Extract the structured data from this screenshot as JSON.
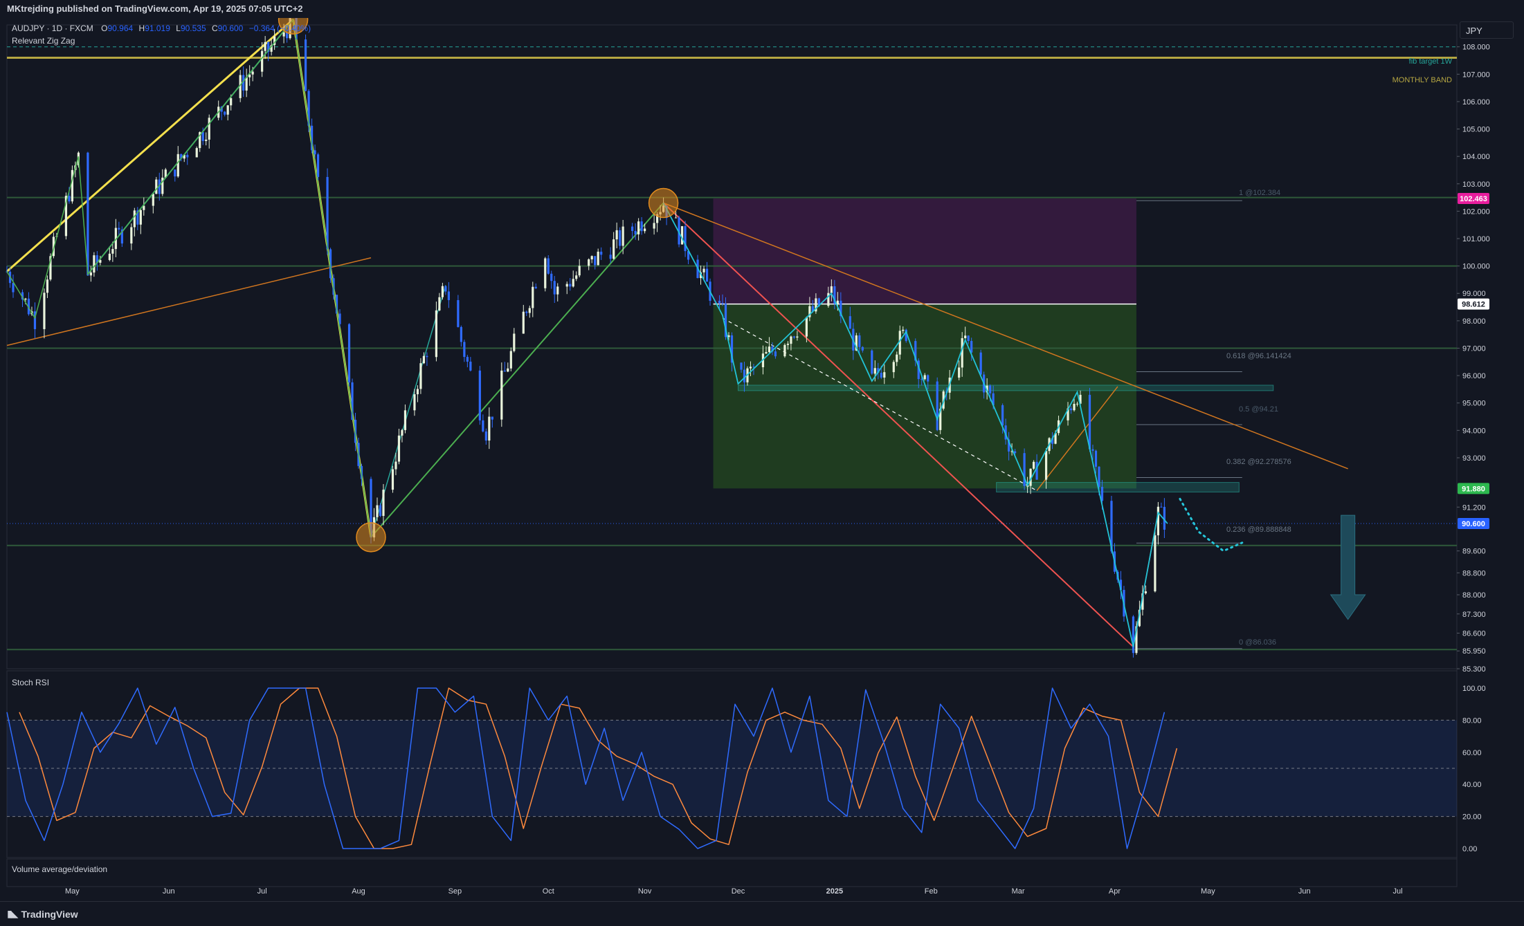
{
  "header": {
    "published_by": "MKtrejding published on TradingView.com, Apr 19, 2025 07:05 UTC+2"
  },
  "legend": {
    "symbol": "AUDJPY · 1D · FXCM",
    "o_label": "O",
    "o_value": "90.964",
    "h_label": "H",
    "h_value": "91.019",
    "l_label": "L",
    "l_value": "90.535",
    "c_label": "C",
    "c_value": "90.600",
    "change": "−0.364 (−0.40%)",
    "indicator": "Relevant Zig Zag"
  },
  "currency_button": "JPY",
  "price_axis": {
    "ticks": [
      "108.000",
      "107.000",
      "106.000",
      "105.000",
      "104.000",
      "103.000",
      "102.000",
      "101.000",
      "100.000",
      "99.000",
      "98.000",
      "97.000",
      "96.000",
      "95.000",
      "94.000",
      "93.000",
      "91.200",
      "89.600",
      "88.800",
      "88.000",
      "87.300",
      "86.600",
      "85.950",
      "85.300"
    ],
    "badges": [
      {
        "text": "102.463",
        "price": 102.463,
        "color": "#e91e9e"
      },
      {
        "text": "98.612",
        "price": 98.612,
        "color": "#ffffff"
      },
      {
        "text": "91.880",
        "price": 91.88,
        "color": "#2db84f"
      },
      {
        "text": "90.600",
        "price": 90.6,
        "color": "#2962ff"
      }
    ]
  },
  "annotations": {
    "fib_target": "fib target 1W",
    "monthly_band": "MONTHLY BAND",
    "fib_1": "1 @102.384",
    "fib_618": "0.618 @96.141424",
    "fib_5": "0.5 @94.21",
    "fib_382": "0.382 @92.278576",
    "fib_236": "0.236 @89.888848",
    "fib_0": "0 @86.036"
  },
  "time_axis": {
    "labels": [
      "May",
      "Jun",
      "Jul",
      "Aug",
      "Sep",
      "Oct",
      "Nov",
      "Dec",
      "2025",
      "Feb",
      "Mar",
      "Apr",
      "May",
      "Jun",
      "Jul"
    ]
  },
  "stoch": {
    "title": "Stoch RSI",
    "ticks": [
      "100.00",
      "80.00",
      "60.00",
      "40.00",
      "20.00",
      "0.00"
    ]
  },
  "volume": {
    "title": "Volume average/deviation"
  },
  "brand": {
    "name": "TradingView"
  },
  "chart_data": [
    {
      "type": "candlestick",
      "symbol": "AUDJPY",
      "timeframe": "1D",
      "ylim": [
        85.3,
        108.8
      ],
      "x_range": [
        "2024-04-10",
        "2025-07-20"
      ],
      "last_close": 90.6,
      "swing_points": [
        {
          "date": "2024-04-10",
          "price": 99.8
        },
        {
          "date": "2024-04-19",
          "price": 98.1
        },
        {
          "date": "2024-05-03",
          "price": 104.0
        },
        {
          "date": "2024-05-06",
          "price": 99.7
        },
        {
          "date": "2024-07-11",
          "price": 109.0
        },
        {
          "date": "2024-08-05",
          "price": 90.1
        },
        {
          "date": "2024-08-29",
          "price": 99.3
        },
        {
          "date": "2024-09-11",
          "price": 94.0
        },
        {
          "date": "2024-09-30",
          "price": 100.6
        },
        {
          "date": "2024-10-03",
          "price": 99.0
        },
        {
          "date": "2024-11-07",
          "price": 102.3
        },
        {
          "date": "2024-11-26",
          "price": 98.2
        },
        {
          "date": "2024-12-01",
          "price": 95.7
        },
        {
          "date": "2024-12-31",
          "price": 99.0
        },
        {
          "date": "2025-01-13",
          "price": 95.8
        },
        {
          "date": "2025-01-24",
          "price": 97.6
        },
        {
          "date": "2025-02-03",
          "price": 94.4
        },
        {
          "date": "2025-02-12",
          "price": 97.3
        },
        {
          "date": "2025-03-04",
          "price": 92.0
        },
        {
          "date": "2025-03-20",
          "price": 95.4
        },
        {
          "date": "2025-04-07",
          "price": 86.1
        },
        {
          "date": "2025-04-15",
          "price": 91.0
        },
        {
          "date": "2025-04-18",
          "price": 90.6
        }
      ],
      "horizontal_levels": [
        108.0,
        107.6,
        102.5,
        100.0,
        97.0,
        89.8,
        86.0
      ],
      "fib_levels": [
        {
          "ratio": 1,
          "price": 102.384
        },
        {
          "ratio": 0.618,
          "price": 96.141424
        },
        {
          "ratio": 0.5,
          "price": 94.21
        },
        {
          "ratio": 0.382,
          "price": 92.278576
        },
        {
          "ratio": 0.236,
          "price": 89.888848
        },
        {
          "ratio": 0,
          "price": 86.036
        }
      ],
      "position_zone": {
        "start": "2024-11-23",
        "end": "2025-04-08",
        "entry": 98.612,
        "stop": 102.463,
        "target": 91.88
      }
    },
    {
      "type": "line",
      "title": "Stoch RSI",
      "ylim": [
        0,
        100
      ],
      "bands": [
        20,
        50,
        80
      ],
      "k_points": [
        {
          "date": "2024-04-10",
          "value": 85
        },
        {
          "date": "2024-04-16",
          "value": 30
        },
        {
          "date": "2024-04-22",
          "value": 5
        },
        {
          "date": "2024-04-28",
          "value": 40
        },
        {
          "date": "2024-05-04",
          "value": 85
        },
        {
          "date": "2024-05-10",
          "value": 60
        },
        {
          "date": "2024-05-16",
          "value": 78
        },
        {
          "date": "2024-05-22",
          "value": 100
        },
        {
          "date": "2024-05-28",
          "value": 65
        },
        {
          "date": "2024-06-03",
          "value": 88
        },
        {
          "date": "2024-06-09",
          "value": 50
        },
        {
          "date": "2024-06-15",
          "value": 20
        },
        {
          "date": "2024-06-21",
          "value": 22
        },
        {
          "date": "2024-06-27",
          "value": 80
        },
        {
          "date": "2024-07-03",
          "value": 100
        },
        {
          "date": "2024-07-09",
          "value": 100
        },
        {
          "date": "2024-07-15",
          "value": 100
        },
        {
          "date": "2024-07-21",
          "value": 40
        },
        {
          "date": "2024-07-27",
          "value": 0
        },
        {
          "date": "2024-08-02",
          "value": 0
        },
        {
          "date": "2024-08-08",
          "value": 0
        },
        {
          "date": "2024-08-14",
          "value": 5
        },
        {
          "date": "2024-08-20",
          "value": 100
        },
        {
          "date": "2024-08-26",
          "value": 100
        },
        {
          "date": "2024-09-01",
          "value": 85
        },
        {
          "date": "2024-09-07",
          "value": 95
        },
        {
          "date": "2024-09-13",
          "value": 20
        },
        {
          "date": "2024-09-19",
          "value": 5
        },
        {
          "date": "2024-09-25",
          "value": 100
        },
        {
          "date": "2024-10-01",
          "value": 80
        },
        {
          "date": "2024-10-07",
          "value": 95
        },
        {
          "date": "2024-10-13",
          "value": 40
        },
        {
          "date": "2024-10-19",
          "value": 75
        },
        {
          "date": "2024-10-25",
          "value": 30
        },
        {
          "date": "2024-10-31",
          "value": 60
        },
        {
          "date": "2024-11-06",
          "value": 20
        },
        {
          "date": "2024-11-12",
          "value": 12
        },
        {
          "date": "2024-11-18",
          "value": 0
        },
        {
          "date": "2024-11-24",
          "value": 5
        },
        {
          "date": "2024-11-30",
          "value": 90
        },
        {
          "date": "2024-12-06",
          "value": 70
        },
        {
          "date": "2024-12-12",
          "value": 100
        },
        {
          "date": "2024-12-18",
          "value": 60
        },
        {
          "date": "2024-12-24",
          "value": 95
        },
        {
          "date": "2024-12-30",
          "value": 30
        },
        {
          "date": "2025-01-05",
          "value": 20
        },
        {
          "date": "2025-01-11",
          "value": 99
        },
        {
          "date": "2025-01-17",
          "value": 65
        },
        {
          "date": "2025-01-23",
          "value": 25
        },
        {
          "date": "2025-01-29",
          "value": 10
        },
        {
          "date": "2025-02-04",
          "value": 90
        },
        {
          "date": "2025-02-10",
          "value": 75
        },
        {
          "date": "2025-02-16",
          "value": 30
        },
        {
          "date": "2025-02-22",
          "value": 15
        },
        {
          "date": "2025-02-28",
          "value": 0
        },
        {
          "date": "2025-03-06",
          "value": 25
        },
        {
          "date": "2025-03-12",
          "value": 100
        },
        {
          "date": "2025-03-18",
          "value": 75
        },
        {
          "date": "2025-03-24",
          "value": 90
        },
        {
          "date": "2025-03-30",
          "value": 70
        },
        {
          "date": "2025-04-05",
          "value": 0
        },
        {
          "date": "2025-04-11",
          "value": 40
        },
        {
          "date": "2025-04-17",
          "value": 85
        }
      ],
      "d_lag_days": 4
    }
  ]
}
